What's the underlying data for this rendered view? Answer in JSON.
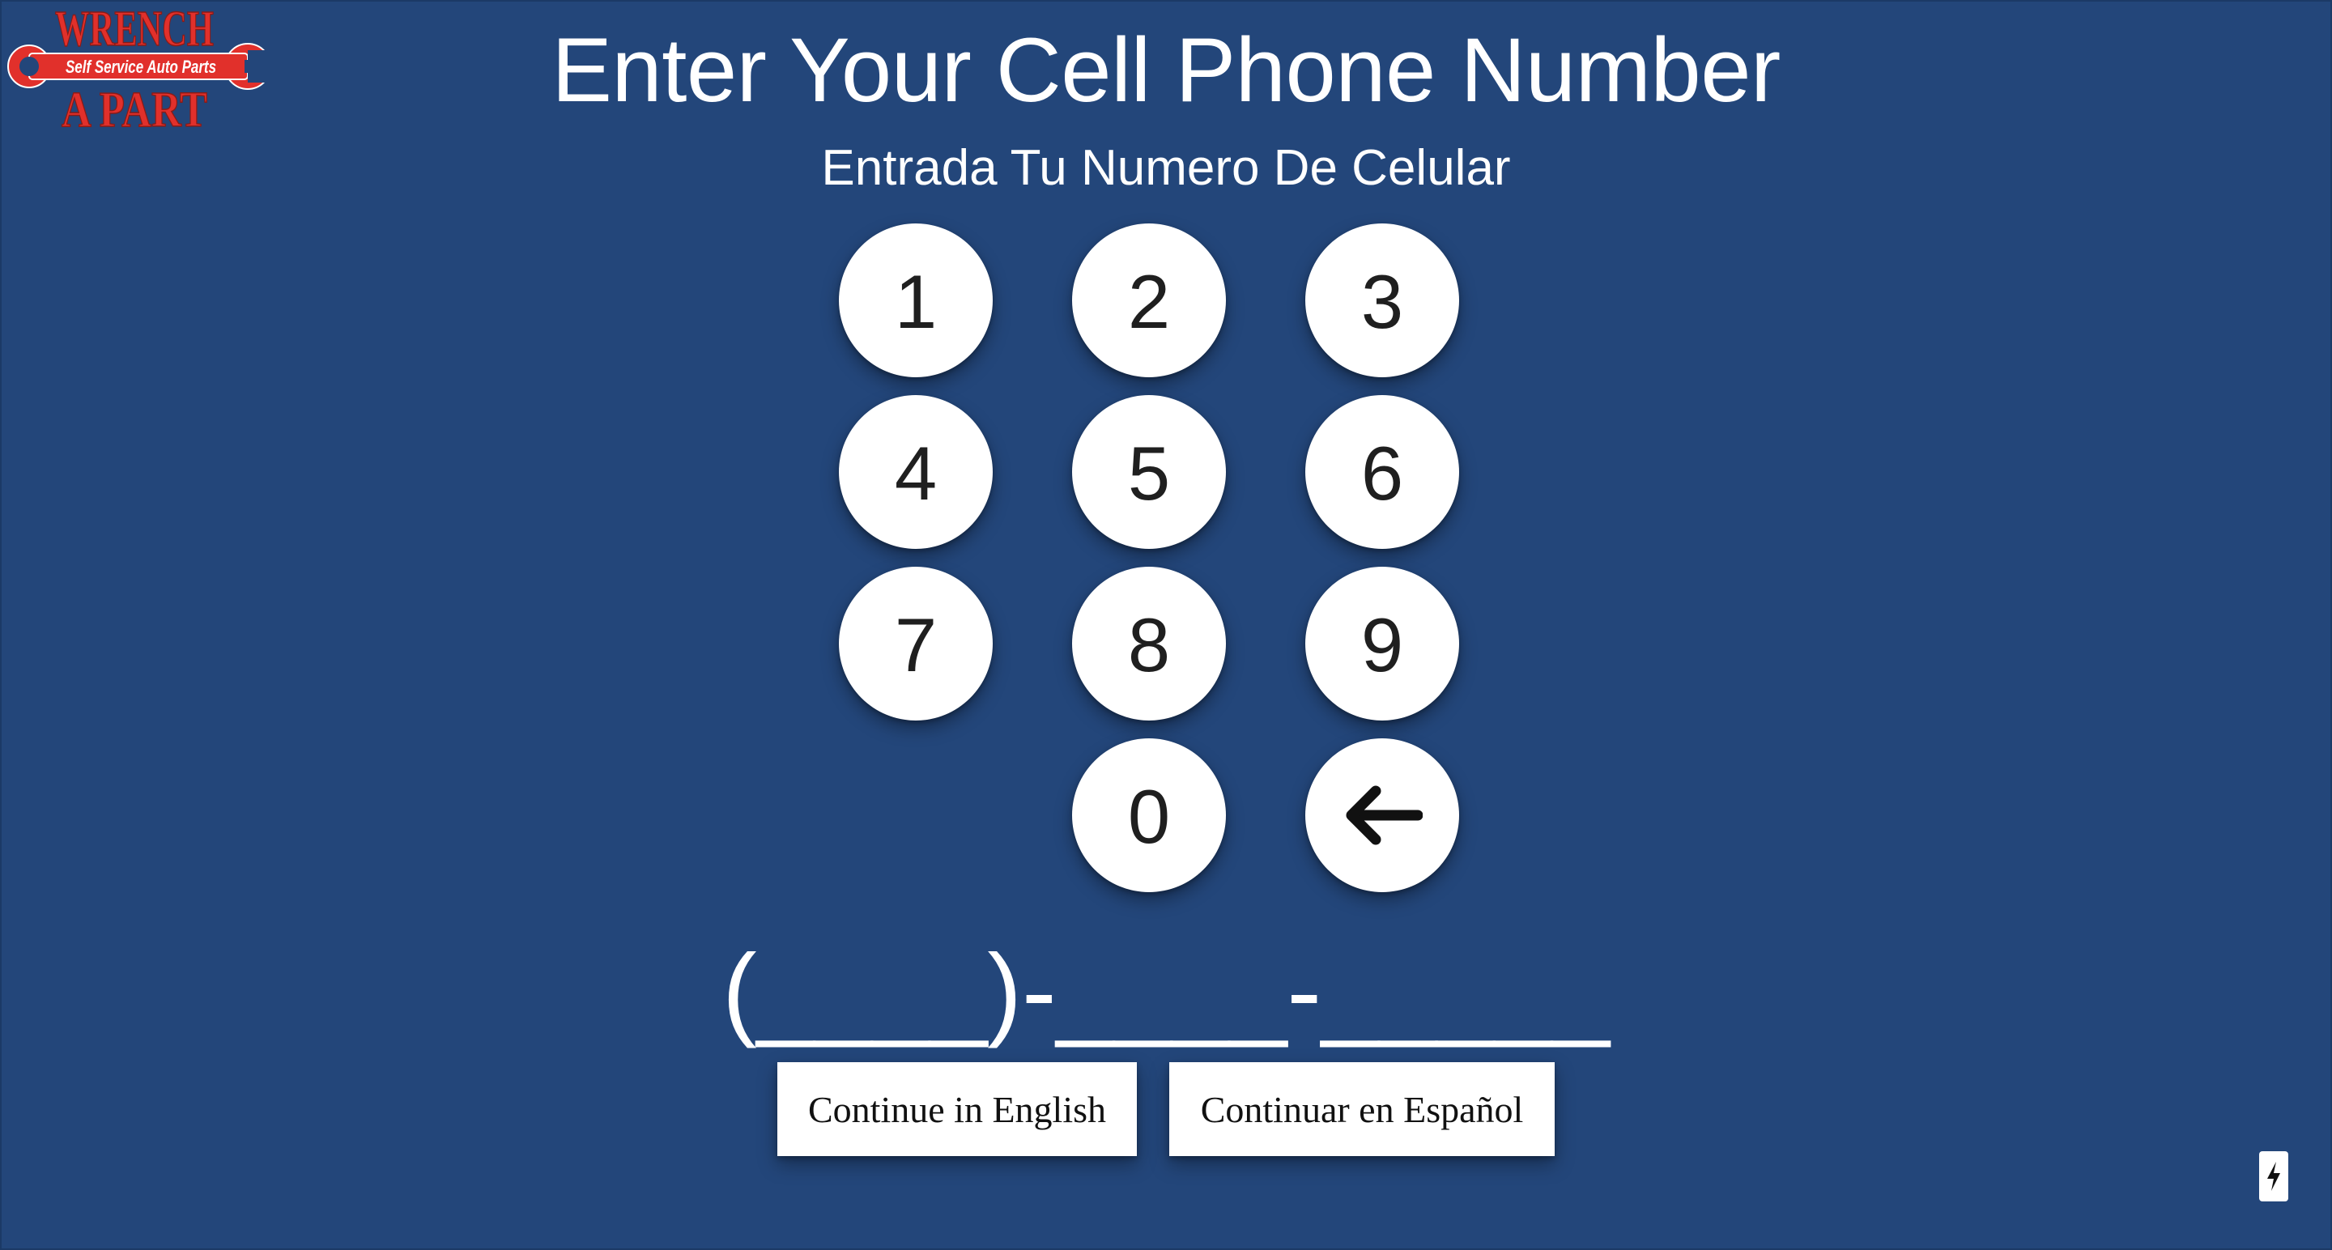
{
  "logo": {
    "line1": "WRENCH",
    "tagline": "Self Service Auto Parts",
    "line2": "A PART"
  },
  "header": {
    "title": "Enter Your Cell Phone Number",
    "subtitle": "Entrada Tu Numero De Celular"
  },
  "keypad": {
    "keys": [
      "1",
      "2",
      "3",
      "4",
      "5",
      "6",
      "7",
      "8",
      "9",
      "0"
    ],
    "backspace_icon": "arrow-left-icon"
  },
  "phone_display": {
    "value": "(____)-____-_____"
  },
  "buttons": {
    "continue_english": "Continue in English",
    "continue_spanish": "Continuar en Español"
  },
  "corner": {
    "icon": "lightning-bolt-icon"
  },
  "colors": {
    "background": "#23467a",
    "key_background": "#ffffff",
    "logo_red": "#e1302b"
  }
}
